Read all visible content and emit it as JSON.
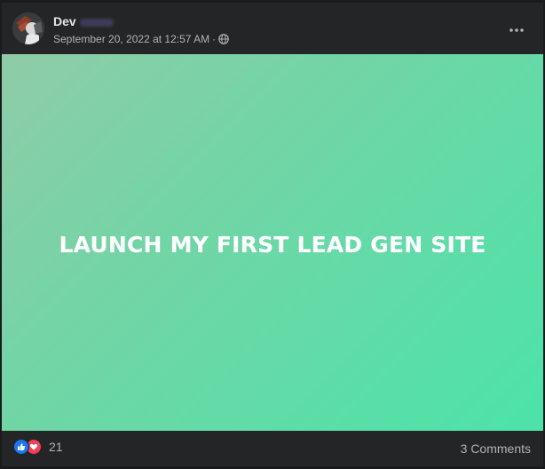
{
  "post": {
    "author": "Dev",
    "timestamp": "September 20, 2022 at 12:57 AM",
    "separator": "·",
    "audience_icon": "globe-icon",
    "menu_icon": "more-horizontal-icon"
  },
  "banner": {
    "text": "LAUNCH MY FIRST LEAD GEN SITE",
    "gradient": [
      "#8fcca8",
      "#4ce3a8"
    ]
  },
  "footer": {
    "reaction_icons": [
      "like-icon",
      "love-icon"
    ],
    "reaction_count": "21",
    "comments": "3 Comments"
  },
  "colors": {
    "card": "#242526",
    "text_primary": "#e4e6eb",
    "text_secondary": "#b0b3b8",
    "like": "#1877f2",
    "love": "#f33e58"
  }
}
